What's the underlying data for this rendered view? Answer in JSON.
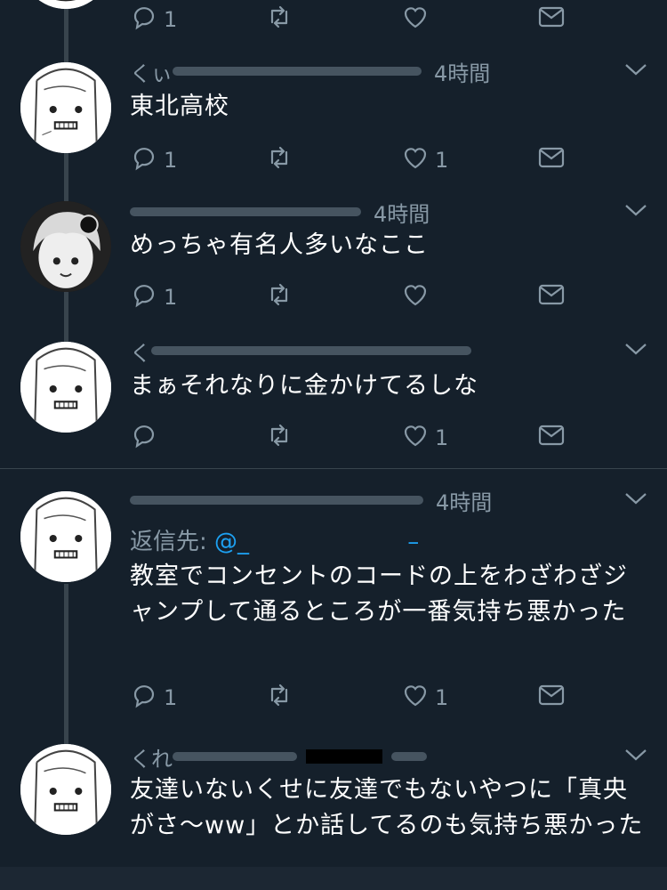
{
  "tweets": [
    {
      "reply_count": "1",
      "like_count": ""
    },
    {
      "user": "くぃ",
      "time": "4時間",
      "text": "東北高校",
      "reply_count": "1",
      "like_count": "1"
    },
    {
      "user": "",
      "time": "4時間",
      "text": "めっちゃ有名人多いなここ",
      "reply_count": "1",
      "like_count": ""
    },
    {
      "user": "く",
      "time": "",
      "text": "まぁそれなりに金かけてるしな",
      "reply_count": "",
      "like_count": "1"
    },
    {
      "user": "",
      "time": "4時間",
      "reply_label": "返信先:",
      "reply_handle": "@_",
      "reply_dash": "–",
      "text": "教室でコンセントのコードの上をわざわざジャンプして通るところが一番気持ち悪かった",
      "reply_count": "1",
      "like_count": "1"
    },
    {
      "user": "くれ",
      "time": "",
      "text": "友達いないくせに友達でもないやつに「真央がさ〜ww」とか話してるのも気持ち悪かった"
    }
  ],
  "icons": {
    "reply": "reply-icon",
    "retweet": "retweet-icon",
    "like": "like-icon",
    "dm": "dm-icon",
    "caret": "chevron-down-icon"
  },
  "colors": {
    "background": "#15202b",
    "secondary_text": "#8899a6",
    "link": "#1da1f2",
    "divider": "#38444d"
  }
}
